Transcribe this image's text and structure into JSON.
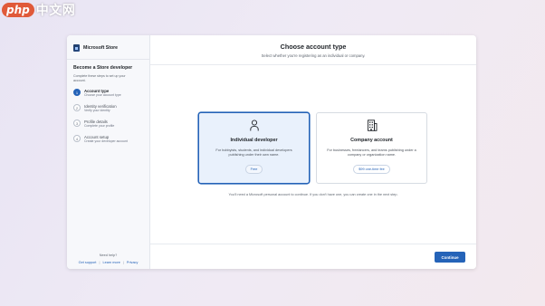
{
  "watermark": {
    "badge": "php",
    "text": "中文网"
  },
  "app": {
    "name": "Microsoft Store"
  },
  "sidebar": {
    "title": "Become a Store developer",
    "description": "Complete these steps to set up your account.",
    "steps": [
      {
        "number": "1",
        "label": "Account type",
        "sub": "Choose your account type",
        "state": "active"
      },
      {
        "number": "2",
        "label": "Identity verification",
        "sub": "Verify your identity",
        "state": "inactive"
      },
      {
        "number": "3",
        "label": "Profile details",
        "sub": "Complete your profile",
        "state": "inactive"
      },
      {
        "number": "4",
        "label": "Account setup",
        "sub": "Create your developer account",
        "state": "inactive"
      }
    ],
    "help": {
      "title": "Need help?",
      "links": [
        "Get support",
        "Learn more",
        "Privacy"
      ],
      "separator": "|"
    }
  },
  "header": {
    "title": "Choose account type",
    "subtitle": "Select whether you're registering as an individual or company."
  },
  "cards": [
    {
      "icon": "person-icon",
      "title": "Individual developer",
      "description": "For hobbyists, students, and individual developers publishing under their own name.",
      "price": "Free",
      "selected": true
    },
    {
      "icon": "building-icon",
      "title": "Company account",
      "description": "For businesses, freelancers, and teams publishing under a company or organization name.",
      "price": "$99 one-time fee",
      "selected": false
    }
  ],
  "note": "You'll need a Microsoft personal account to continue. If you don't have one, you can create one in the next step.",
  "footer": {
    "continue_label": "Continue"
  },
  "colors": {
    "accent": "#2563b8",
    "selected_card_bg": "#e9f1fc",
    "background_start": "#e8e4f3",
    "background_end": "#f3e9ee"
  }
}
